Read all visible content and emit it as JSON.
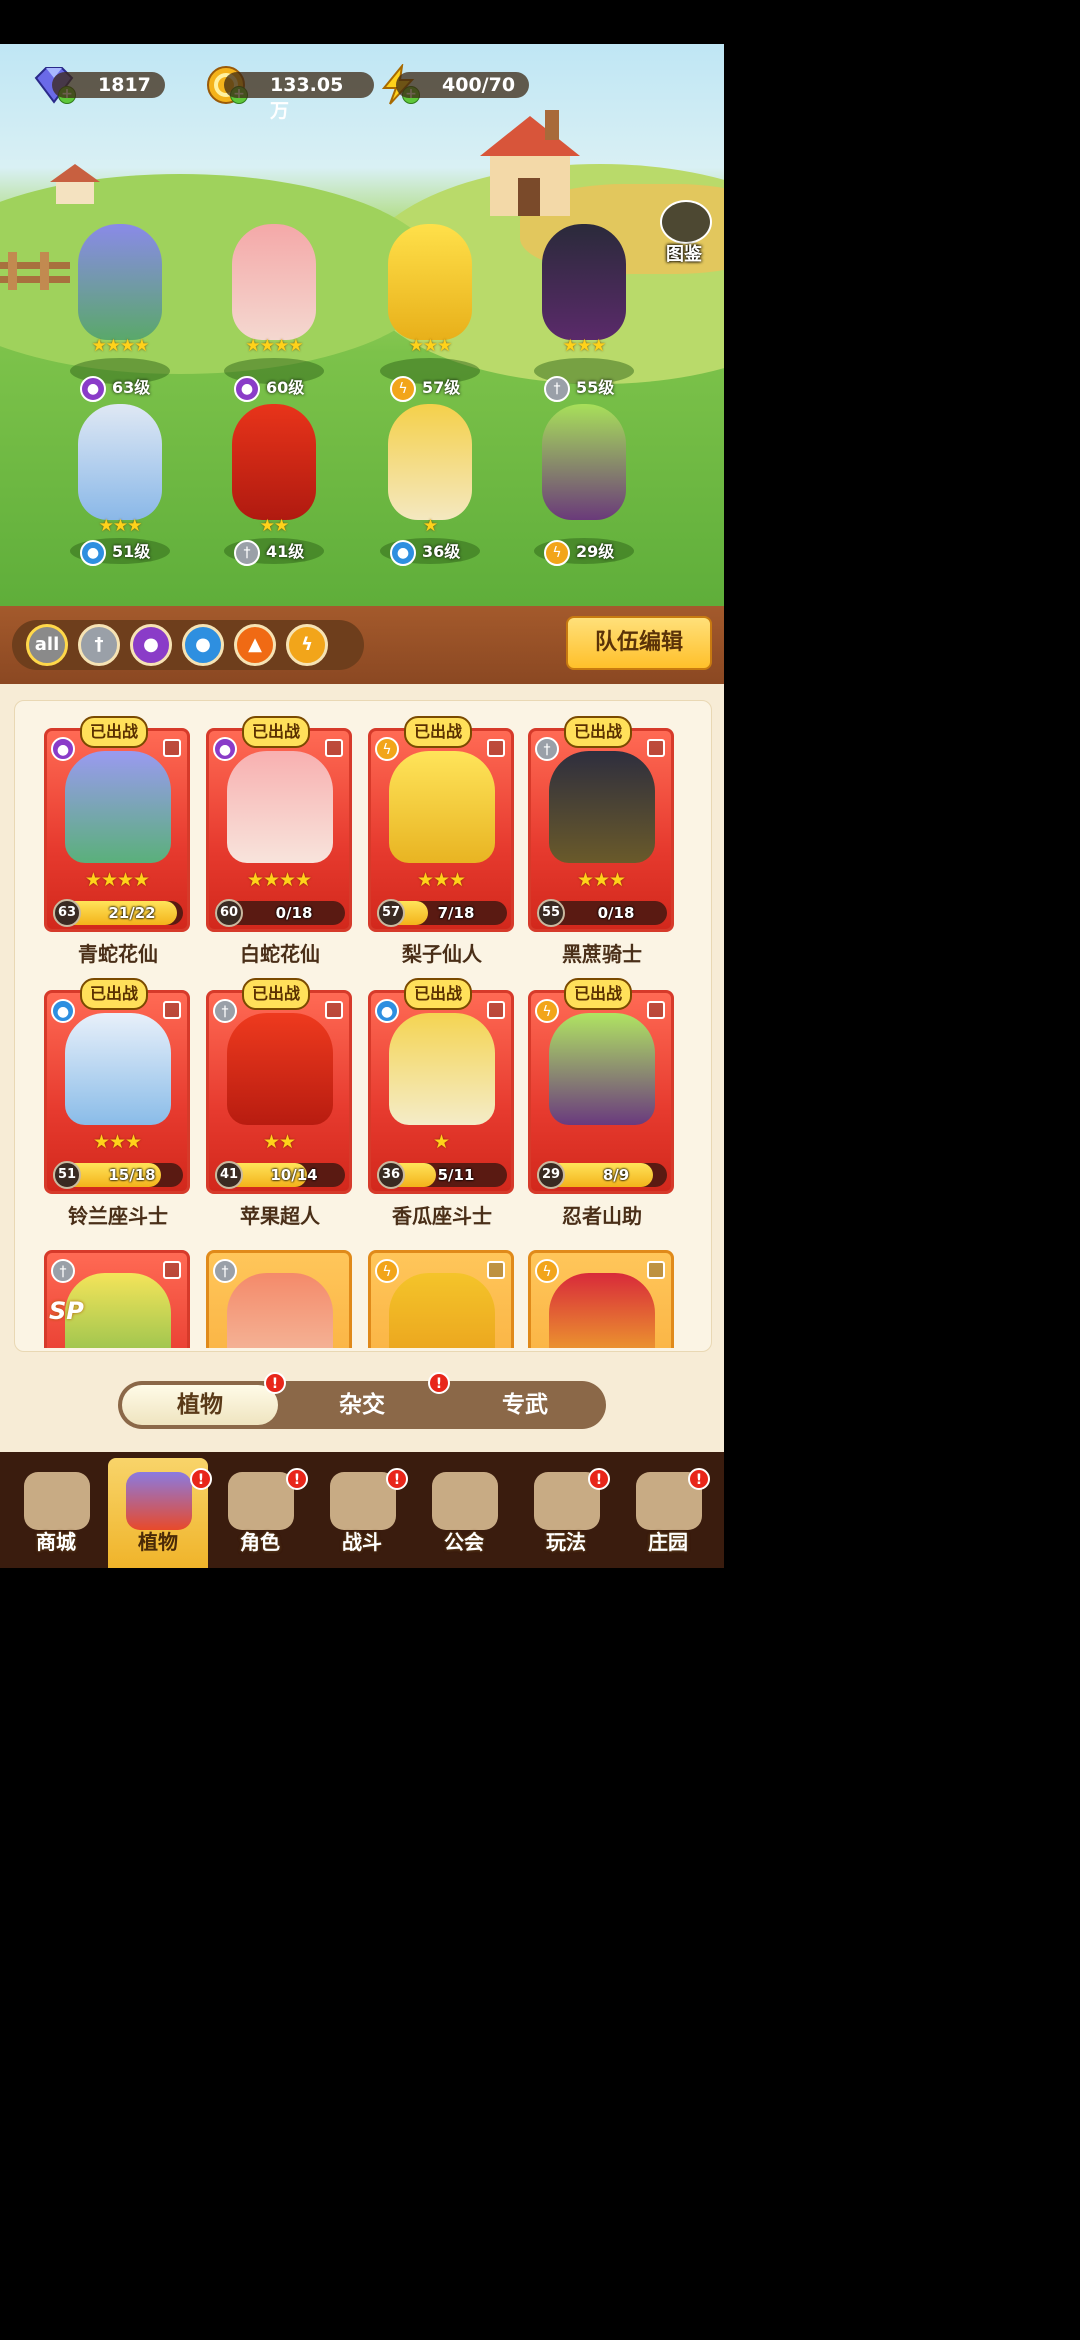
{
  "resources": [
    {
      "icon": "diamond-icon",
      "value": "1817"
    },
    {
      "icon": "gold-coin-icon",
      "value": "133.05万"
    },
    {
      "icon": "energy-icon",
      "value": "400/70"
    }
  ],
  "codex_label": "图鉴",
  "field_units": [
    {
      "element": "poison",
      "stars": 4,
      "level": "63级"
    },
    {
      "element": "poison",
      "stars": 4,
      "level": "60级"
    },
    {
      "element": "thunder",
      "stars": 3,
      "level": "57级"
    },
    {
      "element": "sword",
      "stars": 3,
      "level": "55级"
    },
    {
      "element": "water",
      "stars": 3,
      "level": "51级"
    },
    {
      "element": "sword",
      "stars": 2,
      "level": "41级"
    },
    {
      "element": "water",
      "stars": 1,
      "level": "36级"
    },
    {
      "element": "thunder",
      "stars": 0,
      "level": "29级"
    }
  ],
  "filters": {
    "all_label": "all",
    "icons": [
      "sword-icon",
      "poison-icon",
      "water-icon",
      "fire-icon",
      "thunder-icon"
    ]
  },
  "team_edit_label": "队伍编辑",
  "deployed_label": "已出战",
  "cards": [
    {
      "name": "青蛇花仙",
      "level": "63",
      "progress": "21/22",
      "fraction": 0.95,
      "stars": 4,
      "element": "poison"
    },
    {
      "name": "白蛇花仙",
      "level": "60",
      "progress": "0/18",
      "fraction": 0.0,
      "stars": 4,
      "element": "poison"
    },
    {
      "name": "梨子仙人",
      "level": "57",
      "progress": "7/18",
      "fraction": 0.39,
      "stars": 3,
      "element": "thunder"
    },
    {
      "name": "黑蔗骑士",
      "level": "55",
      "progress": "0/18",
      "fraction": 0.0,
      "stars": 3,
      "element": "sword"
    },
    {
      "name": "铃兰座斗士",
      "level": "51",
      "progress": "15/18",
      "fraction": 0.83,
      "stars": 3,
      "element": "water"
    },
    {
      "name": "苹果超人",
      "level": "41",
      "progress": "10/14",
      "fraction": 0.71,
      "stars": 2,
      "element": "sword"
    },
    {
      "name": "香瓜座斗士",
      "level": "36",
      "progress": "5/11",
      "fraction": 0.45,
      "stars": 1,
      "element": "water"
    },
    {
      "name": "忍者山助",
      "level": "29",
      "progress": "8/9",
      "fraction": 0.89,
      "stars": 0,
      "element": "thunder"
    }
  ],
  "sp_label": "SP",
  "tabs": {
    "plants": "植物",
    "hybrid": "杂交",
    "exclusive": "专武"
  },
  "nav": [
    "商城",
    "植物",
    "角色",
    "战斗",
    "公会",
    "玩法",
    "庄园"
  ],
  "badge_mark": "!",
  "colors": {
    "deployed_bg": "#ffe05a",
    "card_red": "#e63a2e",
    "accent_gold": "#ffc02a"
  }
}
